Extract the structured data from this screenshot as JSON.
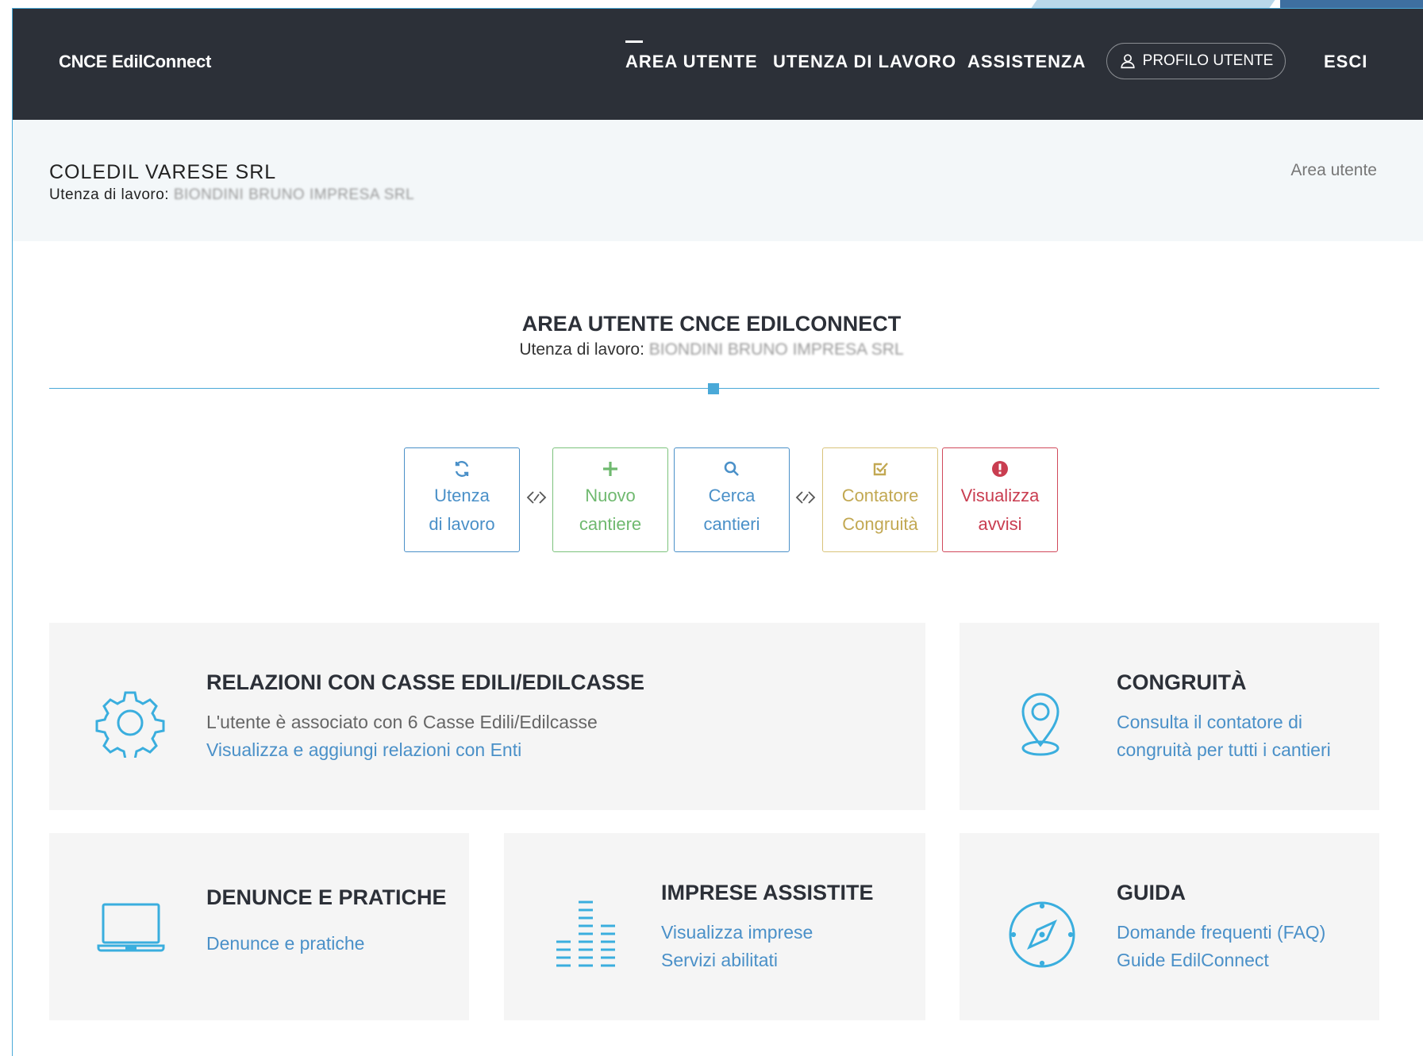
{
  "nav": {
    "brand": "CNCE EdilConnect",
    "items": [
      "AREA UTENTE",
      "UTENZA DI LAVORO",
      "ASSISTENZA"
    ],
    "profile_label": "PROFILO UTENTE",
    "logout_label": "ESCI"
  },
  "header": {
    "company": "COLEDIL VARESE SRL",
    "utenza_prefix": "Utenza di lavoro: ",
    "utenza_value": "BIONDINI BRUNO IMPRESA SRL",
    "breadcrumb": "Area utente"
  },
  "section": {
    "title": "AREA UTENTE CNCE EDILCONNECT",
    "utenza_prefix": "Utenza di lavoro: ",
    "utenza_value": "BIONDINI BRUNO IMPRESA SRL"
  },
  "quick_actions": [
    {
      "line1": "Utenza",
      "line2": "di lavoro",
      "icon": "refresh-icon",
      "color": "#4a90c8"
    },
    {
      "line1": "Nuovo",
      "line2": "cantiere",
      "icon": "plus-icon",
      "color": "#6fb96f"
    },
    {
      "line1": "Cerca",
      "line2": "cantieri",
      "icon": "search-icon",
      "color": "#4a90c8"
    },
    {
      "line1": "Contatore",
      "line2": "Congruità",
      "icon": "check-square-icon",
      "color": "#c2a852"
    },
    {
      "line1": "Visualizza",
      "line2": "avvisi",
      "icon": "alert-icon",
      "color": "#c93d50"
    }
  ],
  "cards": {
    "relazioni": {
      "title": "RELAZIONI CON CASSE EDILI/EDILCASSE",
      "line1": "L'utente è associato con 6 Casse Edili/Edilcasse",
      "line2": "Visualizza e aggiungi relazioni con Enti",
      "icon": "gear-icon"
    },
    "congruita": {
      "title": "CONGRUITÀ",
      "line1": "Consulta il contatore di",
      "line2": "congruità per tutti i cantieri",
      "icon": "map-pin-icon"
    },
    "denunce": {
      "title": "DENUNCE E PRATICHE",
      "line1": "Denunce e pratiche",
      "icon": "laptop-icon"
    },
    "imprese": {
      "title": "IMPRESE ASSISTITE",
      "line1": "Visualizza imprese",
      "line2": "Servizi abilitati",
      "icon": "bar-levels-icon"
    },
    "guida": {
      "title": "GUIDA",
      "line1": "Domande frequenti (FAQ)",
      "line2": "Guide EdilConnect",
      "icon": "compass-icon"
    }
  },
  "colors": {
    "navbar": "#2c3038",
    "accent": "#4aa9d8",
    "link": "#4a90c8",
    "card_bg": "#f5f5f5"
  }
}
